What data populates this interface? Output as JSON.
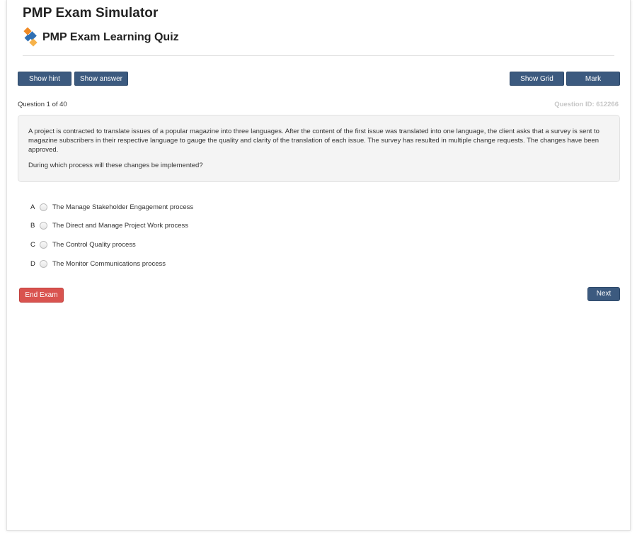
{
  "header": {
    "app_title": "PMP Exam Simulator",
    "quiz_title": "PMP Exam Learning Quiz",
    "logo_icon": "diamond-logo-icon",
    "logo_colors": [
      "#f08a24",
      "#2f6fb3",
      "#f6b24a"
    ]
  },
  "toolbar": {
    "show_hint_label": "Show hint",
    "show_answer_label": "Show answer",
    "show_grid_label": "Show Grid",
    "mark_label": "Mark"
  },
  "question": {
    "counter": "Question 1 of 40",
    "id_label": "Question ID: 612266",
    "paragraph1": "A project is contracted to translate issues of a popular magazine into three languages. After the content of the first issue was translated into one language, the client asks that a survey is sent to magazine subscribers in their respective language to gauge the quality and clarity of the translation of each issue. The survey has resulted in multiple change requests. The changes have been approved.",
    "paragraph2": "During which process will these changes be implemented?"
  },
  "options": [
    {
      "letter": "A",
      "text": "The Manage Stakeholder Engagement process"
    },
    {
      "letter": "B",
      "text": "The Direct and Manage Project Work process"
    },
    {
      "letter": "C",
      "text": "The Control Quality process"
    },
    {
      "letter": "D",
      "text": "The Monitor Communications process"
    }
  ],
  "footer": {
    "end_exam_label": "End Exam",
    "next_label": "Next"
  },
  "colors": {
    "primary_button": "#3c5a7f",
    "danger_button": "#d9534f",
    "muted_text": "#c6c6c6"
  }
}
